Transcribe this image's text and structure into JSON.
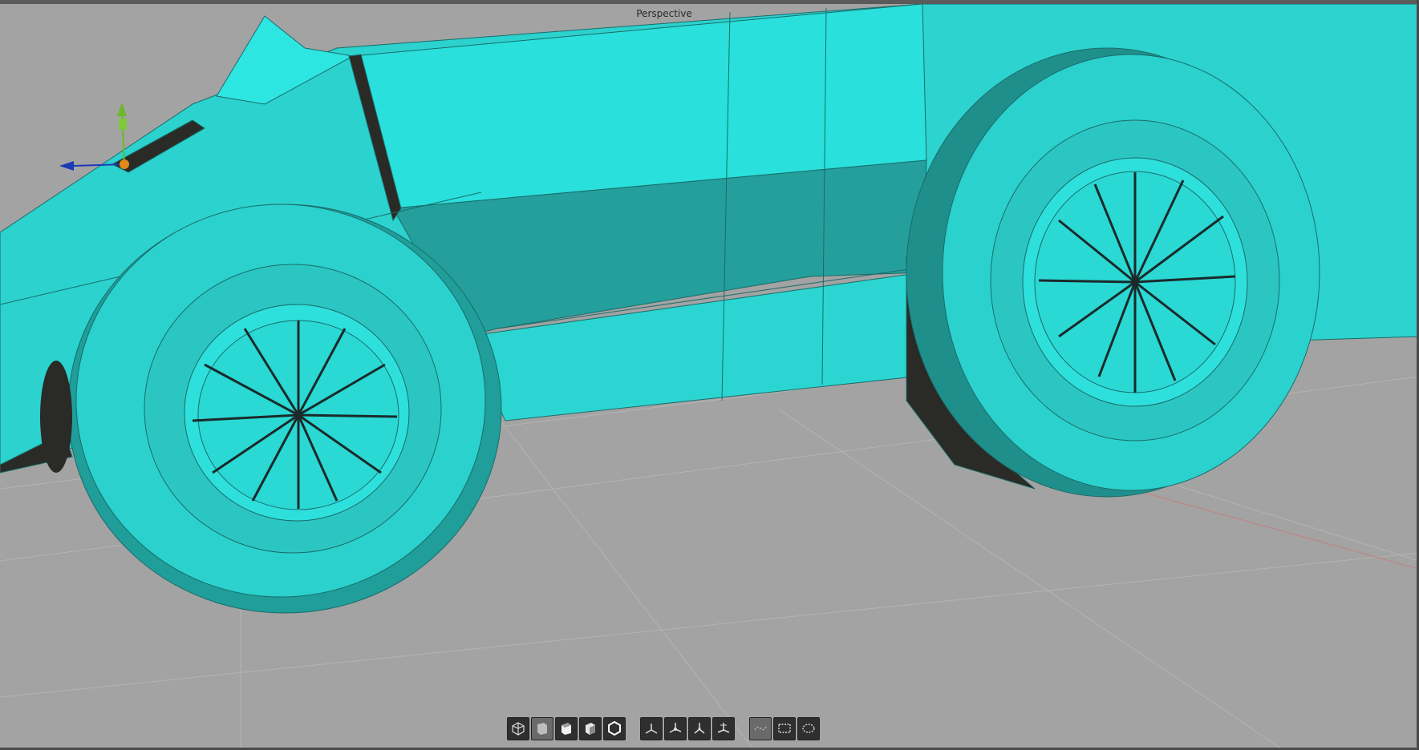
{
  "viewport": {
    "label": "Perspective",
    "background": "#a3a3a3",
    "mesh_color": "#2ad0cc"
  },
  "toolbar": {
    "groups": [
      [
        {
          "name": "wireframe-mode-icon",
          "state": "active"
        },
        {
          "name": "shaded-mode-icon",
          "state": "dim"
        },
        {
          "name": "solid-mode-icon",
          "state": "active"
        },
        {
          "name": "textured-mode-icon",
          "state": "active"
        },
        {
          "name": "hexagon-mode-icon",
          "state": "active"
        }
      ],
      [
        {
          "name": "axis-world-icon",
          "state": "active"
        },
        {
          "name": "axis-local-icon",
          "state": "active"
        },
        {
          "name": "axis-screen-icon",
          "state": "active"
        },
        {
          "name": "axis-view-icon",
          "state": "active"
        }
      ],
      [
        {
          "name": "lasso-select-icon",
          "state": "dim"
        },
        {
          "name": "rect-select-icon",
          "state": "active"
        },
        {
          "name": "ellipse-select-icon",
          "state": "active"
        }
      ]
    ]
  }
}
